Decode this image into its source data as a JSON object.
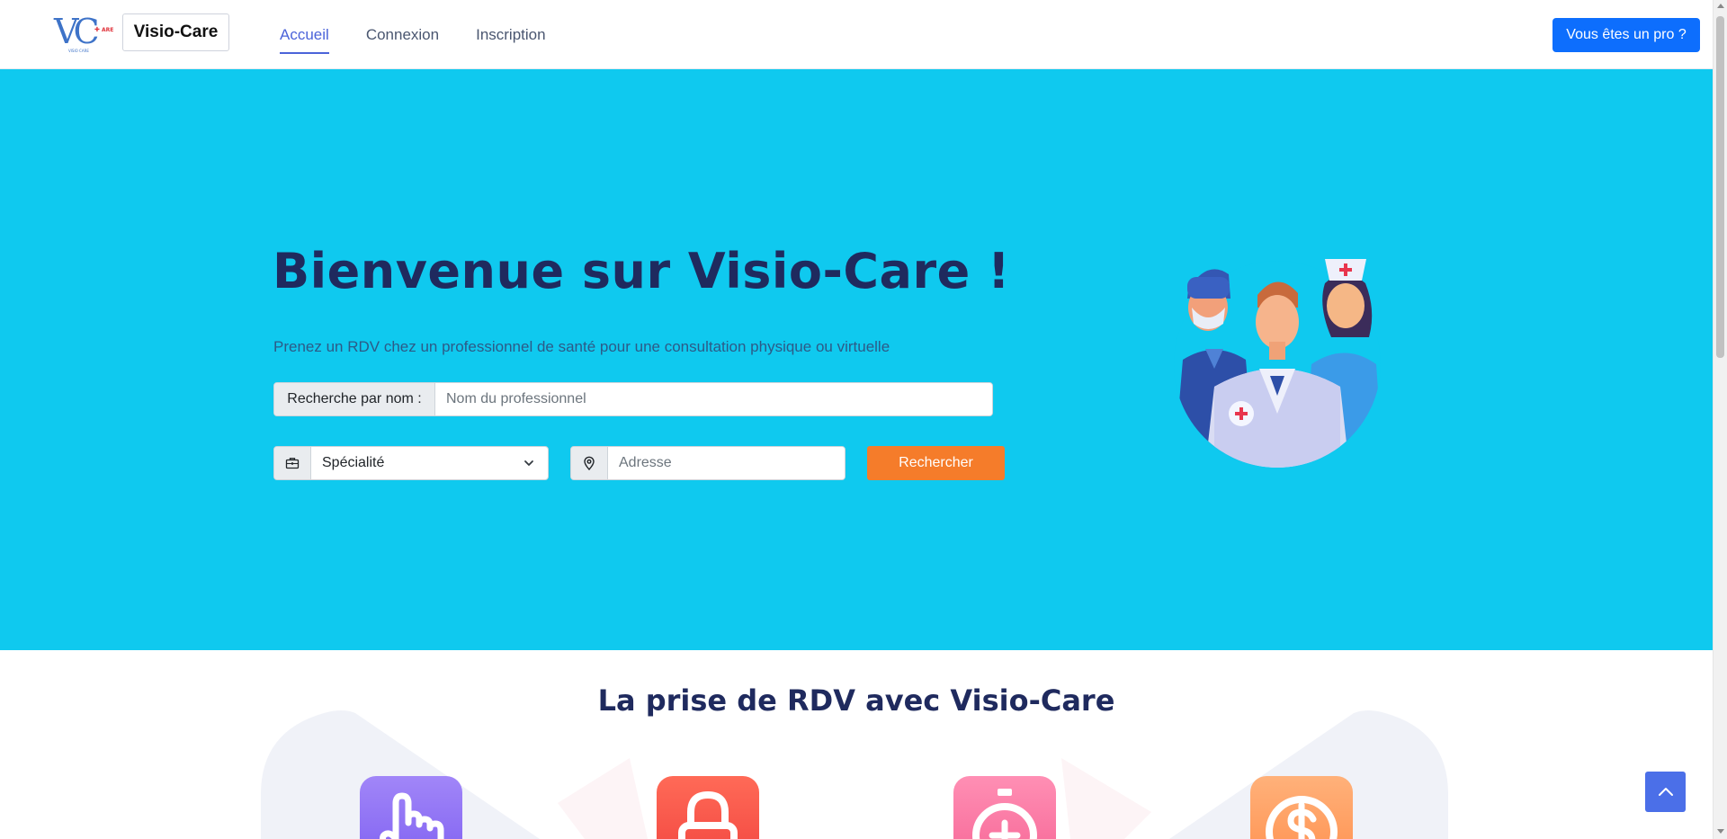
{
  "header": {
    "logo_text": "Visio-Care",
    "logo_mark_letters": "VC",
    "logo_mark_suffix": "ARE",
    "logo_mark_caption": "VISIO CARE",
    "nav": [
      {
        "label": "Accueil",
        "active": true
      },
      {
        "label": "Connexion",
        "active": false
      },
      {
        "label": "Inscription",
        "active": false
      }
    ],
    "pro_button": "Vous êtes un pro ?"
  },
  "hero": {
    "title": "Bienvenue sur Visio-Care !",
    "subtitle": "Prenez un RDV chez un professionnel de santé pour une consultation physique ou virtuelle",
    "name_search": {
      "label": "Recherche par nom :",
      "placeholder": "Nom du professionnel",
      "value": ""
    },
    "specialty": {
      "icon": "medical-kit-icon",
      "selected": "Spécialité"
    },
    "address": {
      "icon": "location-pin-icon",
      "placeholder": "Adresse",
      "value": ""
    },
    "search_button": "Rechercher",
    "illustration": "medical-team-illustration"
  },
  "section2": {
    "title": "La prise de RDV avec Visio-Care",
    "features": [
      {
        "icon": "pointing-hand-icon",
        "color": "#8a6ff5"
      },
      {
        "icon": "lock-icon",
        "color": "#f4503f"
      },
      {
        "icon": "stopwatch-icon",
        "color": "#f76f9c"
      },
      {
        "icon": "dollar-coin-icon",
        "color": "#ff9a5a"
      }
    ]
  },
  "back_to_top_icon": "chevron-up-icon",
  "colors": {
    "hero_bg": "#0fc9ef",
    "primary_btn": "#0d6efd",
    "search_btn": "#f57c2a",
    "title": "#1f2a5e",
    "nav_active": "#4b63d9"
  }
}
